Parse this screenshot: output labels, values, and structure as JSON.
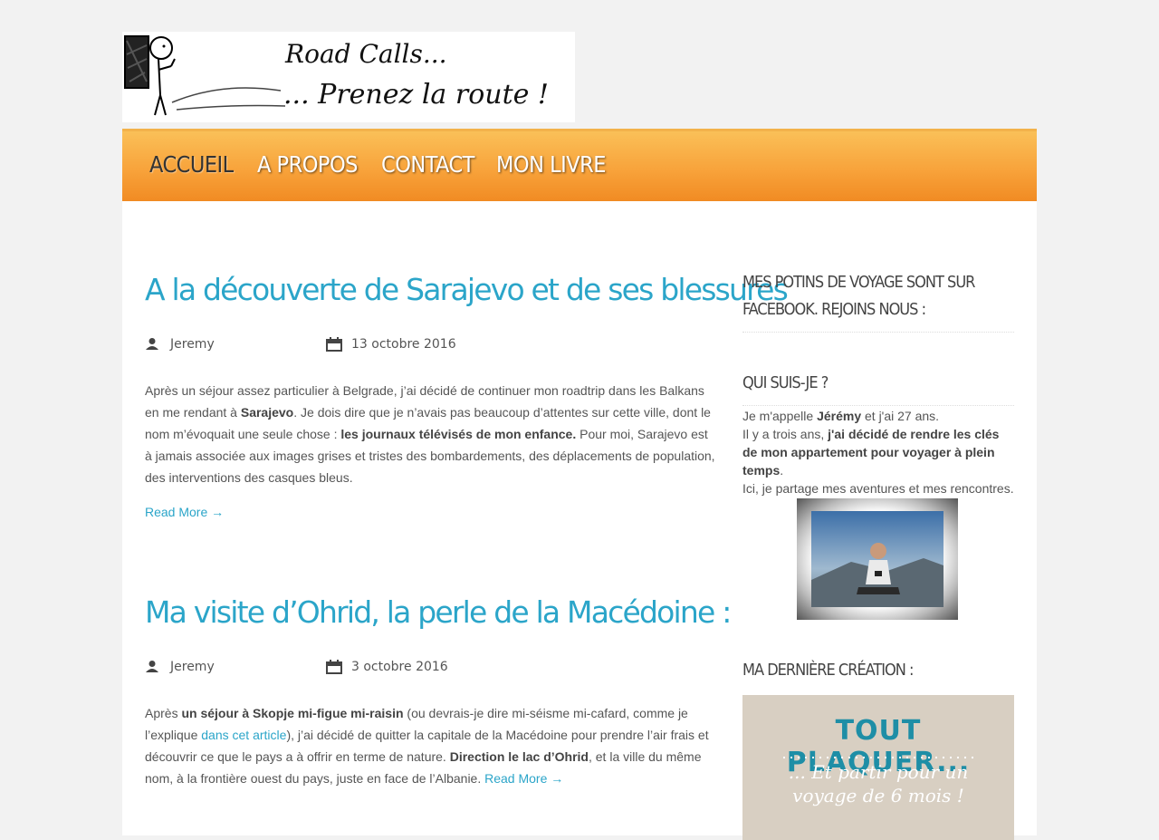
{
  "header": {
    "logo_line1": "Road Calls...",
    "logo_line2": "... Prenez la route !"
  },
  "nav": {
    "items": [
      {
        "label": "ACCUEIL",
        "active": true
      },
      {
        "label": "A PROPOS",
        "active": false
      },
      {
        "label": "CONTACT",
        "active": false
      },
      {
        "label": "MON LIVRE",
        "active": false
      }
    ]
  },
  "posts": [
    {
      "title": "A la découverte de Sarajevo et de ses blessures",
      "author": "Jeremy",
      "date": "13 octobre 2016",
      "excerpt": {
        "p1": "Après un séjour assez particulier à Belgrade, j’ai décidé de continuer mon roadtrip dans les Balkans en me rendant à ",
        "b1": "Sarajevo",
        "p2": ". Je dois dire que je n’avais pas beaucoup d’attentes sur cette ville, dont le nom m’évoquait une seule chose : ",
        "b2": "les journaux télévisés de mon enfance.",
        "p3": " Pour moi, Sarajevo est à jamais associée aux images grises et tristes des bombardements, des déplacements de population, des interventions des casques bleus."
      },
      "read_more": "Read More →"
    },
    {
      "title": "Ma visite d’Ohrid, la perle de la Macédoine :",
      "author": "Jeremy",
      "date": "3 octobre 2016",
      "excerpt": {
        "p1": "Après ",
        "b1": "un séjour à Skopje mi-figue mi-raisin",
        "p2": " (ou devrais-je dire mi-séisme mi-cafard, comme je l’explique ",
        "link": "dans cet article",
        "p3": "), j’ai décidé de quitter la capitale de la Macédoine pour prendre l’air frais et découvrir ce que le pays a à offrir en terme de nature. ",
        "b2": "Direction le lac d’Ohrid",
        "p4": ", et la ville du même nom, à la frontière ouest du pays, juste en face de l’Albanie. "
      },
      "read_more": "Read More →"
    }
  ],
  "sidebar": {
    "facebook_title": "MES POTINS DE VOYAGE SONT SUR FACEBOOK. REJOINS NOUS :",
    "about_title": "QUI SUIS-JE ?",
    "about": {
      "t1": "Je m'appelle ",
      "b1": "Jérémy",
      "t2": " et j'ai 27 ans.",
      "t3": "Il y a trois ans, ",
      "b2": "j'ai décidé de rendre les clés de mon appartement pour voyager à plein temps",
      "t4": ".",
      "t5": "Ici, je partage mes aventures et mes rencontres."
    },
    "creation_title": "MA DERNIÈRE CRÉATION :",
    "book": {
      "title": "TOUT PLAQUER...",
      "subtitle_line1": "... Et partir pour un",
      "subtitle_line2": "voyage de 6 mois !"
    }
  },
  "colors": {
    "accent": "#2ba5c9",
    "nav_orange": "#f8a33b"
  }
}
